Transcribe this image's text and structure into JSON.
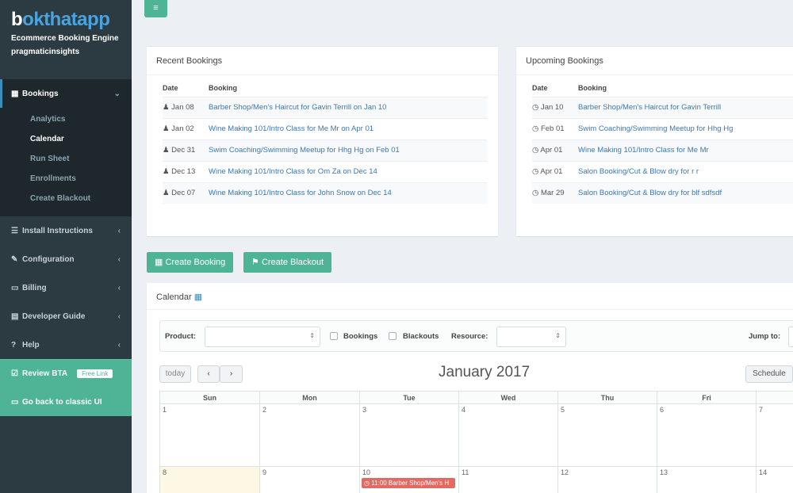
{
  "brand": {
    "logo_part1": "b",
    "logo_part2": "ok",
    "logo_part3": "thatapp",
    "subtitle": "Ecommerce Booking Engine",
    "account": "pragmaticinsights"
  },
  "sidebar": {
    "bookings": {
      "label": "Bookings",
      "icon": "calendar-icon"
    },
    "sub_items": [
      "Analytics",
      "Calendar",
      "Run Sheet",
      "Enrollments",
      "Create Blackout"
    ],
    "items": [
      {
        "label": "Install Instructions",
        "icon": "list-icon"
      },
      {
        "label": "Configuration",
        "icon": "edit-icon"
      },
      {
        "label": "Billing",
        "icon": "credit-card-icon"
      },
      {
        "label": "Developer Guide",
        "icon": "book-icon"
      },
      {
        "label": "Help",
        "icon": "question-icon"
      }
    ],
    "review": {
      "label": "Review BTA",
      "badge": "Free Link"
    },
    "classic": {
      "label": "Go back to classic UI"
    }
  },
  "recent": {
    "title": "Recent Bookings",
    "col_date": "Date",
    "col_booking": "Booking",
    "rows": [
      {
        "date": "Jan 08",
        "booking": "Barber Shop/Men's Haircut for Gavin Terrill on Jan 10"
      },
      {
        "date": "Jan 02",
        "booking": "Wine Making 101/Intro Class for Me Mr on Apr 01"
      },
      {
        "date": "Dec 31",
        "booking": "Swim Coaching/Swimming Meetup for Hhg Hg on Feb 01"
      },
      {
        "date": "Dec 13",
        "booking": "Wine Making 101/Intro Class for Om Za on Dec 14"
      },
      {
        "date": "Dec 07",
        "booking": "Wine Making 101/Intro Class for John Snow on Dec 14"
      }
    ]
  },
  "upcoming": {
    "title": "Upcoming Bookings",
    "col_date": "Date",
    "col_booking": "Booking",
    "rows": [
      {
        "date": "Jan 10",
        "booking": "Barber Shop/Men's Haircut for Gavin Terrill"
      },
      {
        "date": "Feb 01",
        "booking": "Swim Coaching/Swimming Meetup for Hhg Hg"
      },
      {
        "date": "Apr 01",
        "booking": "Wine Making 101/Intro Class for Me Mr"
      },
      {
        "date": "Apr 01",
        "booking": "Salon Booking/Cut & Blow dry for r r"
      },
      {
        "date": "Mar 29",
        "booking": "Salon Booking/Cut & Blow dry for blf sdfsdf"
      }
    ]
  },
  "actions": {
    "create_booking": "Create Booking",
    "create_blackout": "Create Blackout"
  },
  "calendar": {
    "title": "Calendar",
    "filters": {
      "product_label": "Product:",
      "bookings_label": "Bookings",
      "blackouts_label": "Blackouts",
      "resource_label": "Resource:",
      "jump_label": "Jump to:"
    },
    "today_label": "today",
    "prev_label": "‹",
    "next_label": "›",
    "month": "January 2017",
    "schedule_label": "Schedule",
    "days": [
      "Sun",
      "Mon",
      "Tue",
      "Wed",
      "Thu",
      "Fri"
    ],
    "week1": [
      "1",
      "2",
      "3",
      "4",
      "5",
      "6",
      "7"
    ],
    "week2": [
      "8",
      "9",
      "10",
      "11",
      "12",
      "13",
      "14"
    ],
    "event": "11:00 Barber Shop/Men's H"
  },
  "colors": {
    "accent": "#4fb395",
    "sidebar": "#2c3b41",
    "link": "#3c78b4",
    "event": "#e26a63"
  }
}
